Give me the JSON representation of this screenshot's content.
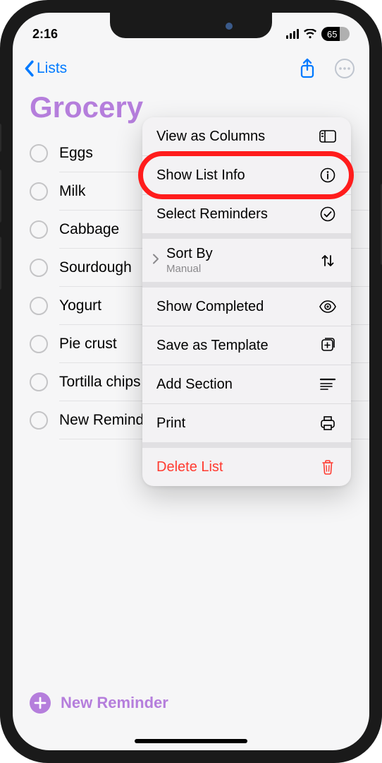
{
  "status": {
    "time": "2:16",
    "battery_text": "65"
  },
  "nav": {
    "back_label": "Lists"
  },
  "list": {
    "title": "Grocery",
    "items": [
      {
        "text": "Eggs"
      },
      {
        "text": "Milk"
      },
      {
        "text": "Cabbage"
      },
      {
        "text": "Sourdough"
      },
      {
        "text": "Yogurt"
      },
      {
        "text": "Pie crust"
      },
      {
        "text": "Tortilla chips"
      },
      {
        "text": "New Reminder"
      }
    ]
  },
  "menu": {
    "view_columns": "View as Columns",
    "show_list_info": "Show List Info",
    "select_reminders": "Select Reminders",
    "sort_by": "Sort By",
    "sort_by_value": "Manual",
    "show_completed": "Show Completed",
    "save_template": "Save as Template",
    "add_section": "Add Section",
    "print": "Print",
    "delete_list": "Delete List"
  },
  "footer": {
    "new_reminder": "New Reminder"
  }
}
